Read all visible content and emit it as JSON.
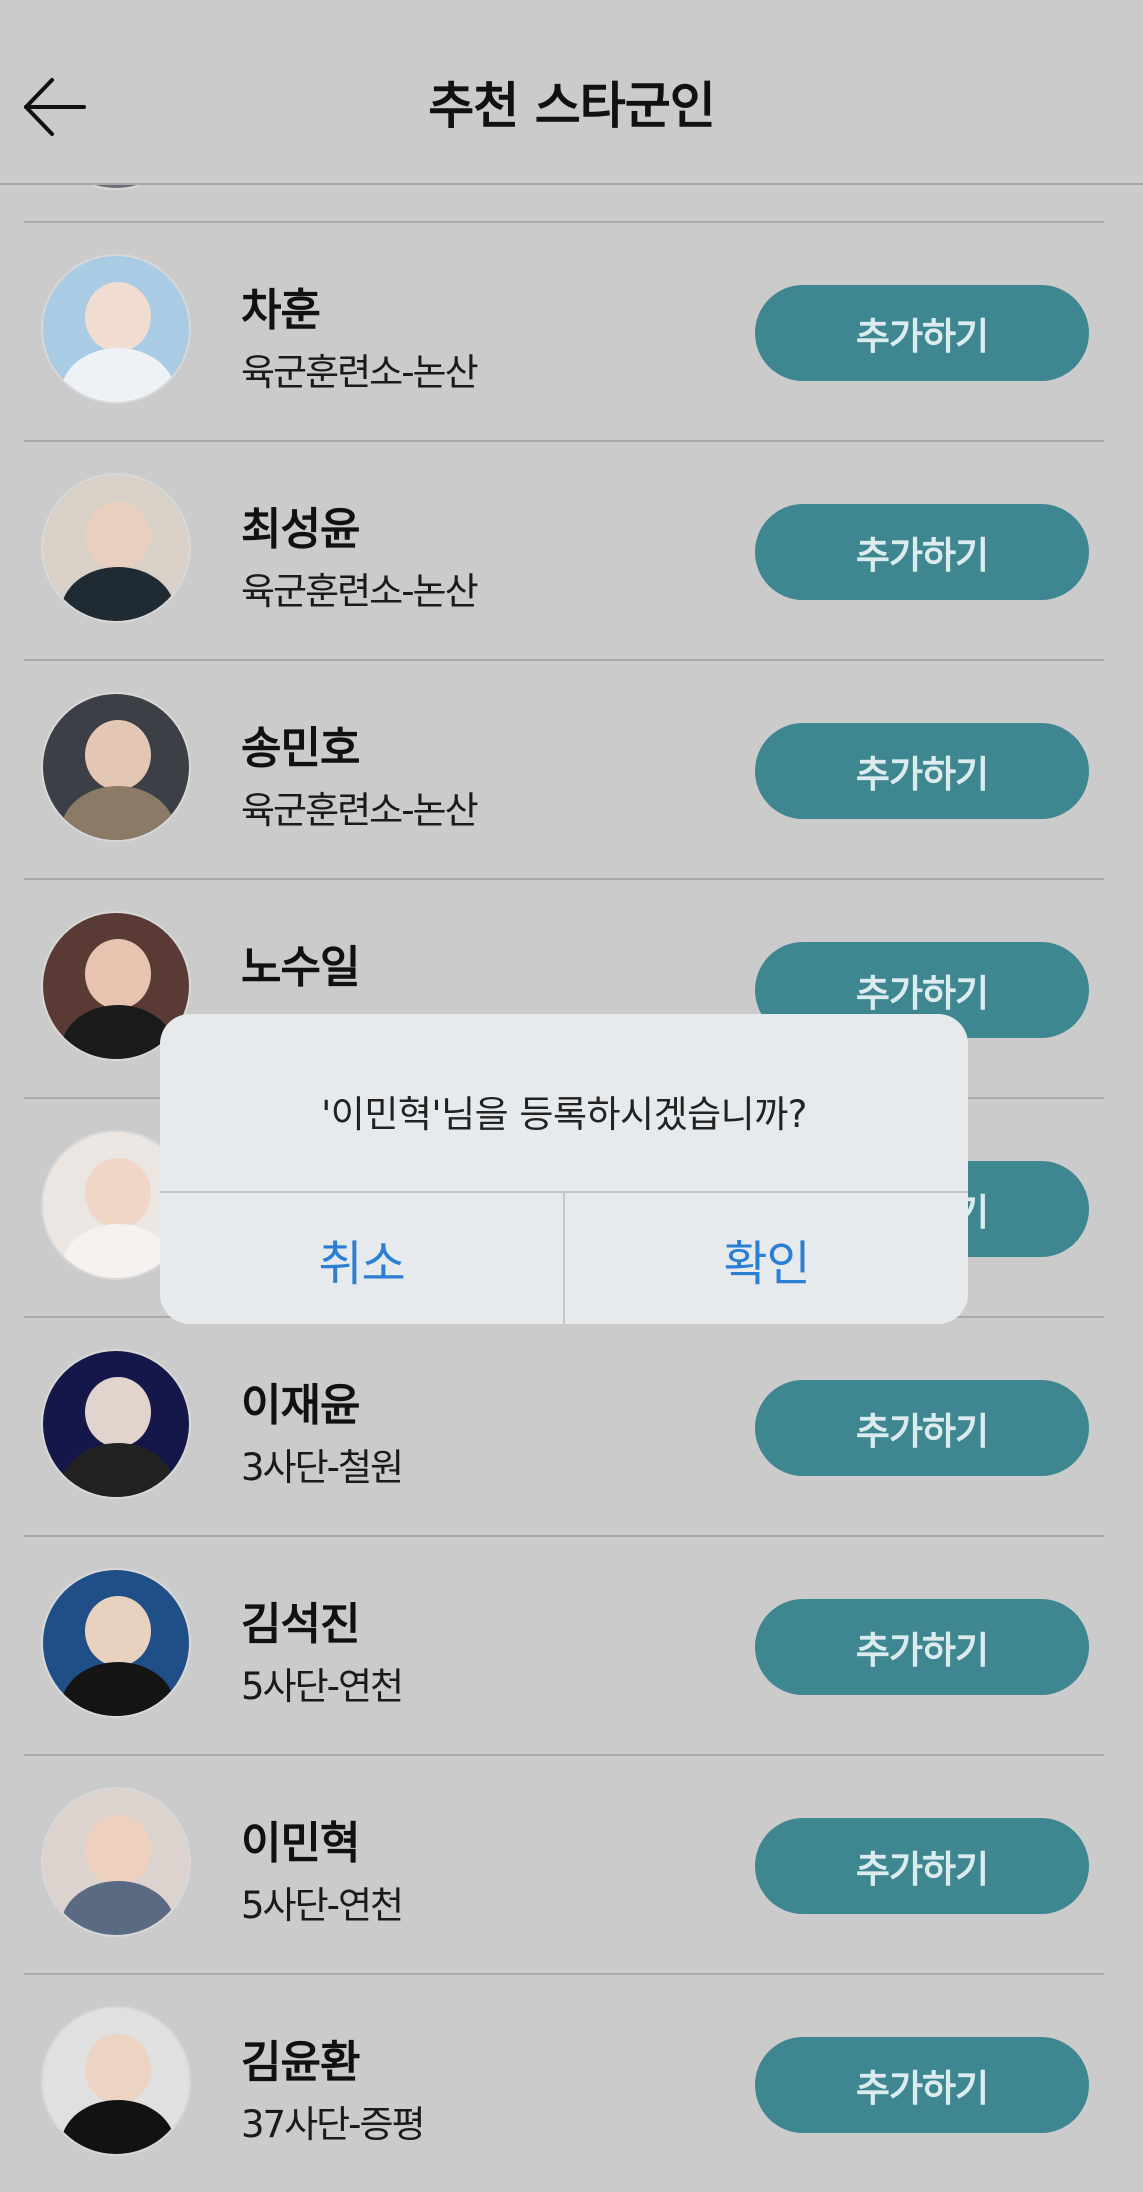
{
  "header": {
    "title": "추천 스타군인"
  },
  "list": {
    "add_label": "추가하기",
    "items": [
      {
        "name": "차훈",
        "unit": "육군훈련소-논산"
      },
      {
        "name": "최성윤",
        "unit": "육군훈련소-논산"
      },
      {
        "name": "송민호",
        "unit": "육군훈련소-논산"
      },
      {
        "name": "노수일",
        "unit": ""
      },
      {
        "name": "",
        "unit": ""
      },
      {
        "name": "이재윤",
        "unit": "3사단-철원"
      },
      {
        "name": "김석진",
        "unit": "5사단-연천"
      },
      {
        "name": "이민혁",
        "unit": "5사단-연천"
      },
      {
        "name": "김윤환",
        "unit": "37사단-증평"
      }
    ]
  },
  "dialog": {
    "message": "'이민혁'님을 등록하시겠습니까?",
    "cancel_label": "취소",
    "confirm_label": "확인"
  },
  "colors": {
    "background": "#cbcbcb",
    "accent": "#3e8690",
    "dialog_button": "#2a7fd4"
  },
  "icons": {
    "back": "arrow-left-icon"
  }
}
